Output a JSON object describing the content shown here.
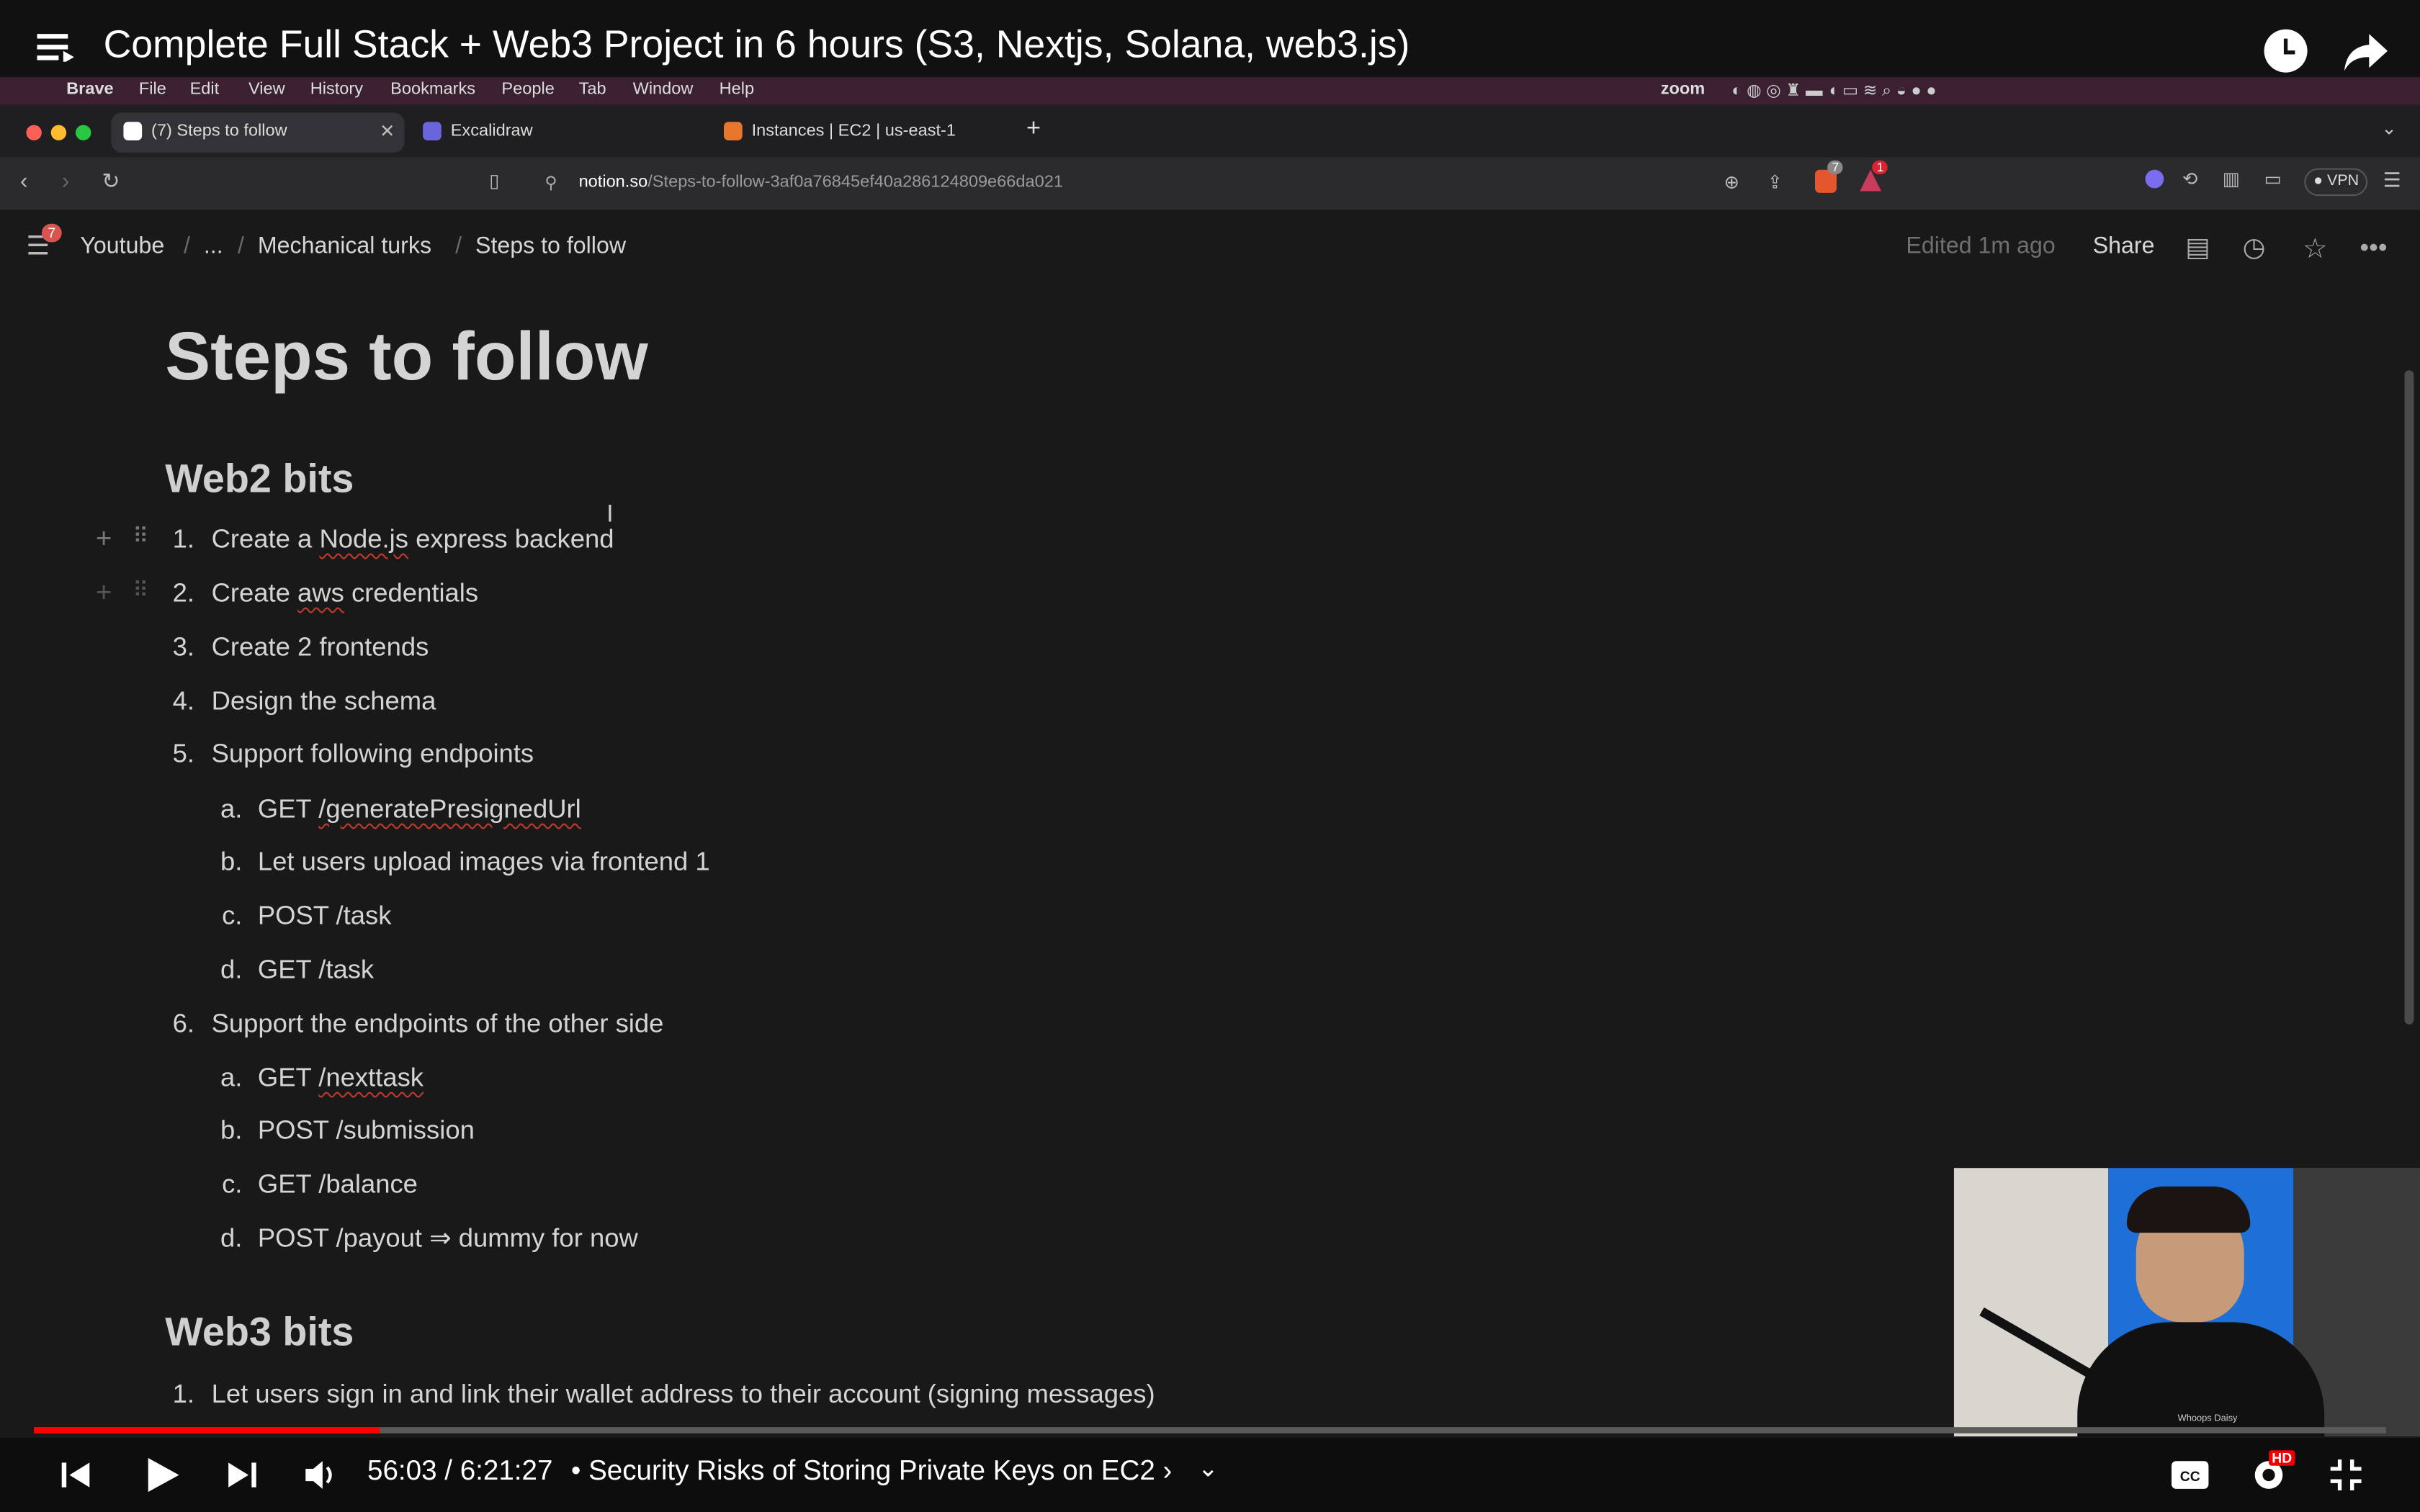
{
  "video": {
    "title": "Complete Full Stack + Web3 Project in 6 hours (S3, Nextjs, Solana, web3.js)",
    "time_current": "56:03",
    "time_total": "6:21:27",
    "chapter": "• Security Risks of Storing Private Keys on EC2",
    "progress": 0.147,
    "hd_badge": "HD",
    "icons": [
      "playlist-icon",
      "watch-later-icon",
      "share-icon",
      "previous-icon",
      "play-icon",
      "next-icon",
      "volume-icon",
      "captions-icon",
      "settings-icon",
      "exit-fullscreen-icon"
    ]
  },
  "menubar": {
    "items": [
      "Brave",
      "File",
      "Edit",
      "View",
      "History",
      "Bookmarks",
      "People",
      "Tab",
      "Window",
      "Help"
    ],
    "zoom": "zoom"
  },
  "browser": {
    "tabs": [
      {
        "label": "(7) Steps to follow",
        "active": true
      },
      {
        "label": "Excalidraw",
        "active": false
      },
      {
        "label": "Instances | EC2 | us-east-1",
        "active": false
      }
    ],
    "url_host": "notion.so",
    "url_path": "/Steps-to-follow-3af0a76845ef40a286124809e66da021",
    "shield_count": "7",
    "alert_count": "1",
    "vpn_label": "VPN"
  },
  "notion": {
    "notif_count": "7",
    "breadcrumb": [
      "Youtube",
      "...",
      "Mechanical turks",
      "Steps to follow"
    ],
    "edited": "Edited 1m ago",
    "share": "Share",
    "page_title": "Steps to follow",
    "sections": [
      {
        "heading": "Web2 bits",
        "items": [
          {
            "n": "1.",
            "text": "Create a Node.js express backend"
          },
          {
            "n": "2.",
            "text": "Create aws credentials"
          },
          {
            "n": "3.",
            "text": "Create 2 frontends"
          },
          {
            "n": "4.",
            "text": "Design the schema"
          },
          {
            "n": "5.",
            "text": "Support following endpoints",
            "sub": [
              {
                "n": "a.",
                "text": "GET /generatePresignedUrl"
              },
              {
                "n": "b.",
                "text": "Let users upload images via frontend 1"
              },
              {
                "n": "c.",
                "text": "POST /task"
              },
              {
                "n": "d.",
                "text": "GET /task"
              }
            ]
          },
          {
            "n": "6.",
            "text": "Support the endpoints of the other side",
            "sub": [
              {
                "n": "a.",
                "text": "GET /nexttask"
              },
              {
                "n": "b.",
                "text": "POST /submission"
              },
              {
                "n": "c.",
                "text": "GET /balance"
              },
              {
                "n": "d.",
                "text": "POST /payout  ⇒ dummy for now"
              }
            ]
          }
        ]
      },
      {
        "heading": "Web3 bits",
        "items": [
          {
            "n": "1.",
            "text": "Let users sign in and link their wallet address to their account (signing messages)"
          }
        ]
      }
    ]
  },
  "webcam": {
    "caption": "Whoops Daisy"
  },
  "colors": {
    "progress": "#ff0000",
    "page_bg": "#191919",
    "text": "#d4d4d4"
  }
}
